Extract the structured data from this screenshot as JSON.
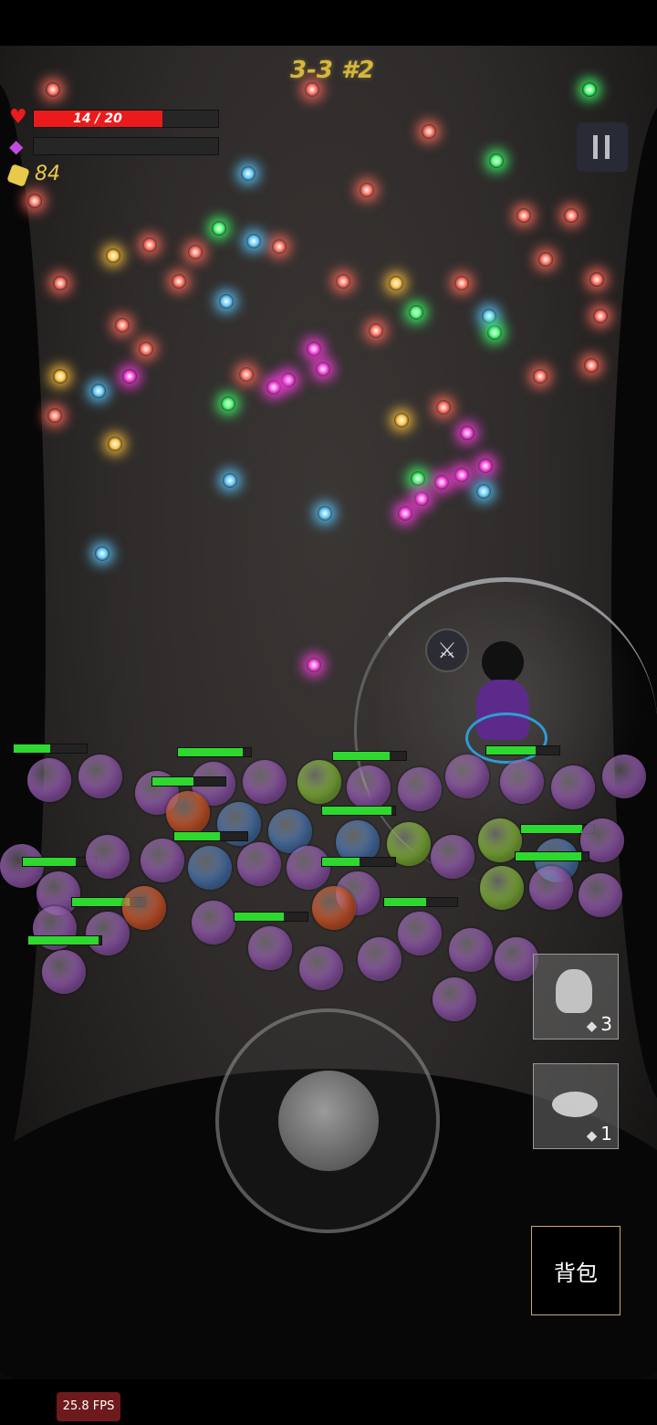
{
  "hud": {
    "health": {
      "current": 14,
      "max": 20,
      "text": "14 / 20",
      "fraction": 0.7,
      "icon": "heart-icon",
      "color": "#ec1b1b"
    },
    "mana": {
      "fraction": 0.0,
      "icon": "purple-gem-icon",
      "color": "#c44be0"
    },
    "coins": {
      "value": "84",
      "icon": "gold-coin-icon",
      "color": "#e9c94a"
    },
    "wave_label": "3-3 #2",
    "pause_icon": "pause-icon"
  },
  "skills": [
    {
      "name": "fist-skill",
      "icon": "fist-icon",
      "count": "3"
    },
    {
      "name": "seed-pouch-skill",
      "icon": "seed-pouch-icon",
      "count": "1"
    }
  ],
  "controls": {
    "joystick": "virtual-joystick",
    "bag_label": "背包"
  },
  "debug": {
    "fps": "25.8 FPS"
  },
  "colors": {
    "enemy_purple": "#8e56a8",
    "enemy_blue": "#4a72a8",
    "enemy_green": "#7fae3a",
    "enemy_orange": "#c8552a",
    "projectile_red": "#ff6a5a",
    "projectile_magenta": "#ff3de0",
    "projectile_green": "#3dff6a",
    "projectile_blue": "#5ac8ff",
    "projectile_yellow": "#ffc23d"
  }
}
